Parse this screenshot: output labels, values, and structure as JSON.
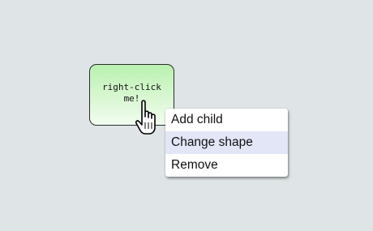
{
  "node": {
    "label": "right-click me!"
  },
  "context_menu": {
    "items": [
      {
        "label": "Add child",
        "highlighted": false
      },
      {
        "label": "Change shape",
        "highlighted": true
      },
      {
        "label": "Remove",
        "highlighted": false
      }
    ]
  },
  "cursor": {
    "icon": "hand-pointer-icon"
  },
  "colors": {
    "background": "#dfe5e6",
    "node_gradient_top": "#b9f1b0",
    "node_gradient_bottom": "#f2fdf0",
    "menu_highlight": "#e3e6f7"
  }
}
